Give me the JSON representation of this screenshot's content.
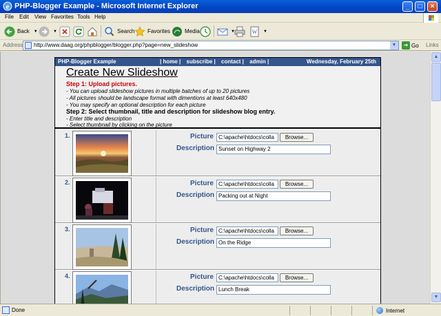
{
  "window": {
    "title": "PHP-Blogger Example - Microsoft Internet Explorer",
    "min": "_",
    "max": "□",
    "close": "×"
  },
  "menubar": [
    "File",
    "Edit",
    "View",
    "Favorites",
    "Tools",
    "Help"
  ],
  "toolbar": {
    "back": "Back",
    "search": "Search",
    "favorites": "Favorites",
    "media": "Media"
  },
  "address": {
    "label": "Address",
    "url": "http://www.daag.org/phpblogger/blogger.php?page=new_slideshow",
    "go": "Go",
    "links": "Links"
  },
  "blog": {
    "site_name": "PHP-Blogger Example",
    "nav": [
      "| home |",
      "subscribe |",
      "contact |",
      "admin |"
    ],
    "date": "Wednesday, February 25th",
    "page_title": "Create New Slideshow",
    "step1_label": "Step 1:  Upload pictures.",
    "step1_lines": [
      "- You can upload slideshow pictures in multiple batches of up to 20 pictures",
      "- All pictures should be landscape format with dimentions at least 640x480",
      "- You may specify an optional description for each picture"
    ],
    "step2_label": "Step 2:  Select thumbnail, title and description for slideshow blog entry.",
    "step2_lines": [
      "- Enter title and description",
      "- Select thumbnail by clicking on the picture"
    ],
    "picture_label": "Picture",
    "description_label": "Description",
    "browse_label": "Browse...",
    "rows": [
      {
        "num": "1.",
        "file": "C:\\apache\\htdocs\\colla",
        "description": "Sunset on Highway 2",
        "scene": "sunset"
      },
      {
        "num": "2.",
        "file": "C:\\apache\\htdocs\\colla",
        "description": "Packing out at Night",
        "scene": "night"
      },
      {
        "num": "3.",
        "file": "C:\\apache\\htdocs\\colla",
        "description": "On the Ridge",
        "scene": "ridge"
      },
      {
        "num": "4.",
        "file": "C:\\apache\\htdocs\\colla",
        "description": "Lunch Break",
        "scene": "mountains"
      }
    ]
  },
  "status": {
    "text": "Done",
    "zone": "Internet"
  }
}
